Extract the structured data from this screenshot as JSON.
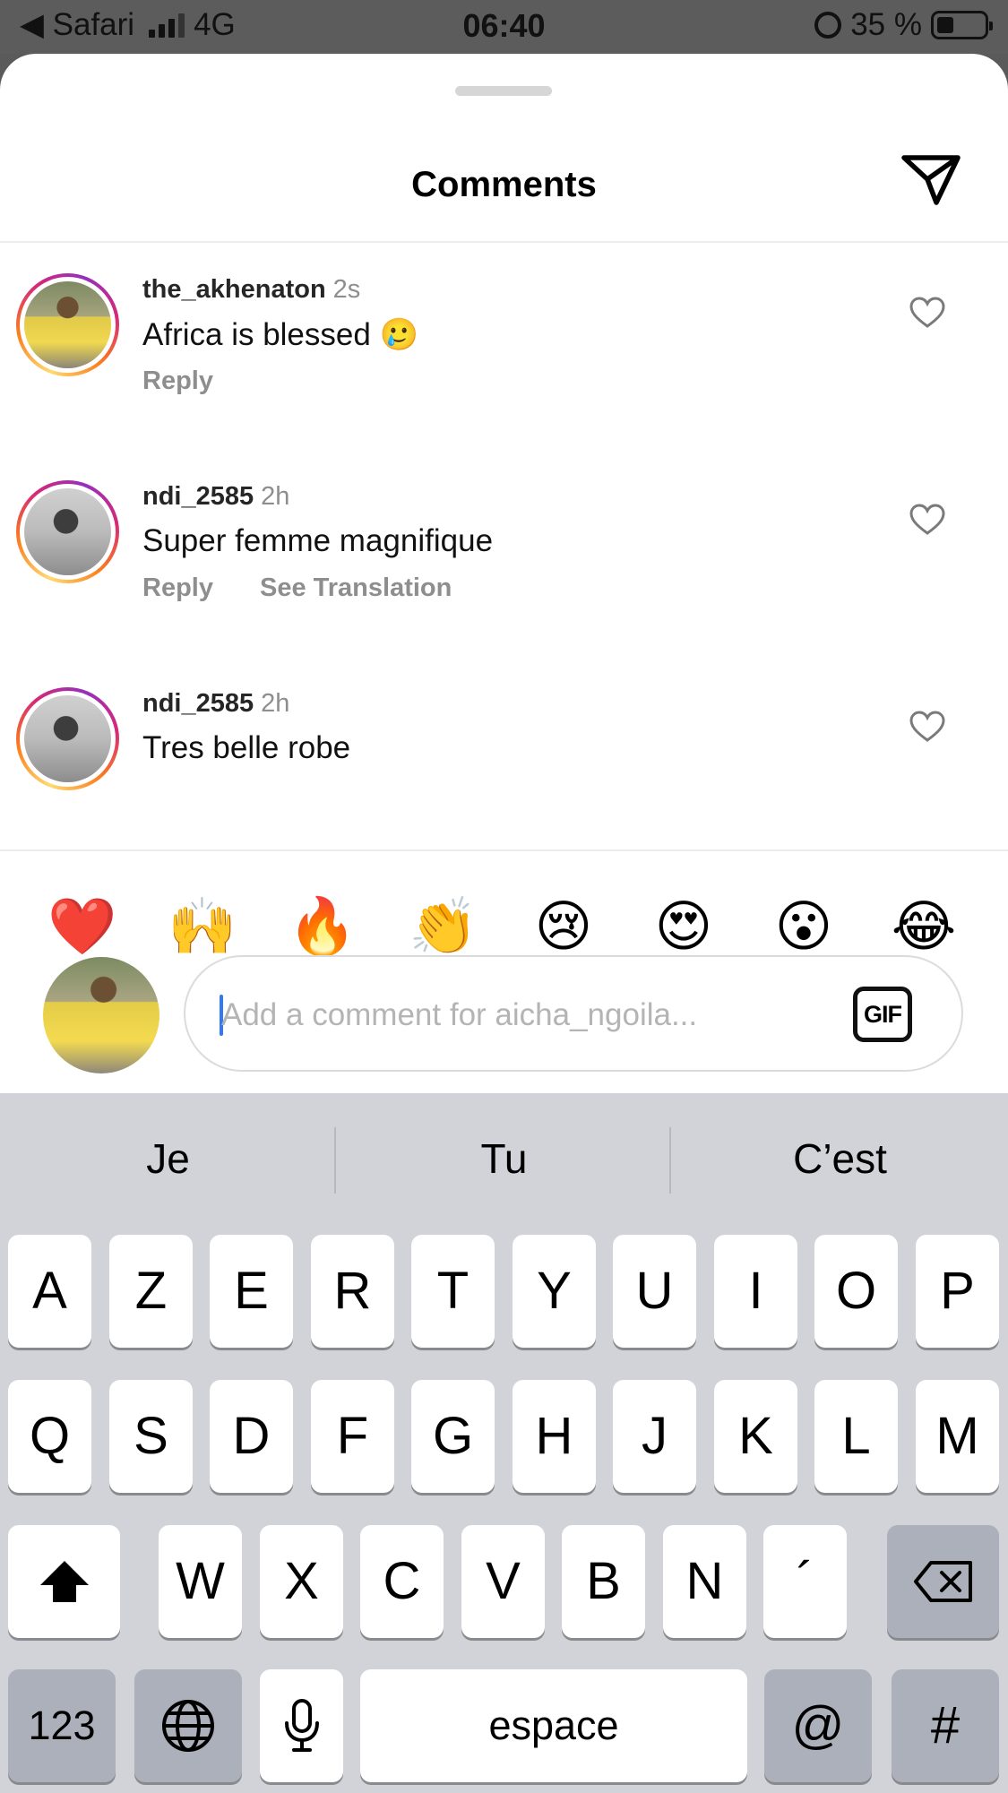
{
  "status_bar": {
    "back_label": "◀ Safari",
    "network": "4G",
    "time": "06:40",
    "battery": "35 %",
    "battery_level": 0.35
  },
  "sheet": {
    "title": "Comments"
  },
  "comments": [
    {
      "username": "the_akhenaton",
      "time": "2s",
      "text": "Africa is blessed 🥲",
      "actions": [
        "Reply"
      ]
    },
    {
      "username": "ndi_2585",
      "time": "2h",
      "text": "Super femme magnifique",
      "actions": [
        "Reply",
        "See Translation"
      ]
    },
    {
      "username": "ndi_2585",
      "time": "2h",
      "text": "Tres belle robe",
      "actions": []
    }
  ],
  "reactions": [
    "❤️",
    "🙌",
    "🔥",
    "👏",
    "😢",
    "😍",
    "😮",
    "😂"
  ],
  "composer": {
    "placeholder": "Add a comment for aicha_ngoila...",
    "gif_label": "GIF"
  },
  "keyboard": {
    "suggestions": [
      "Je",
      "Tu",
      "C’est"
    ],
    "row1": [
      "A",
      "Z",
      "E",
      "R",
      "T",
      "Y",
      "U",
      "I",
      "O",
      "P"
    ],
    "row2": [
      "Q",
      "S",
      "D",
      "F",
      "G",
      "H",
      "J",
      "K",
      "L",
      "M"
    ],
    "row3": [
      "W",
      "X",
      "C",
      "V",
      "B",
      "N",
      "´"
    ],
    "numbers_label": "123",
    "space_label": "espace",
    "at_label": "@",
    "hash_label": "#"
  },
  "colors": {
    "ring_gradient": [
      "#feda75",
      "#fa7e1e",
      "#d62976",
      "#962fbf"
    ],
    "caret": "#3478f6",
    "secondary_text": "#8e8e8e"
  }
}
